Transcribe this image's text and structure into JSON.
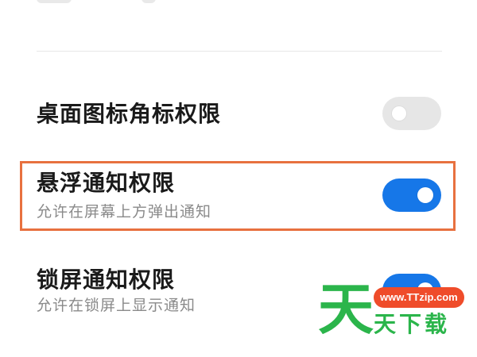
{
  "settings": [
    {
      "title": "桌面图标角标权限",
      "description": "",
      "enabled": false
    },
    {
      "title": "悬浮通知权限",
      "description": "允许在屏幕上方弹出通知",
      "enabled": true
    },
    {
      "title": "锁屏通知权限",
      "description": "允许在锁屏上显示通知",
      "enabled": true
    }
  ],
  "watermark": {
    "url": "www.TTzip.com",
    "big_char": "天",
    "text": "天下载"
  },
  "colors": {
    "toggle_on": "#1677e8",
    "toggle_off": "#e6e6e6",
    "highlight": "#e8713f",
    "watermark_green": "#2bb54b",
    "watermark_red": "#ef4c2a"
  }
}
